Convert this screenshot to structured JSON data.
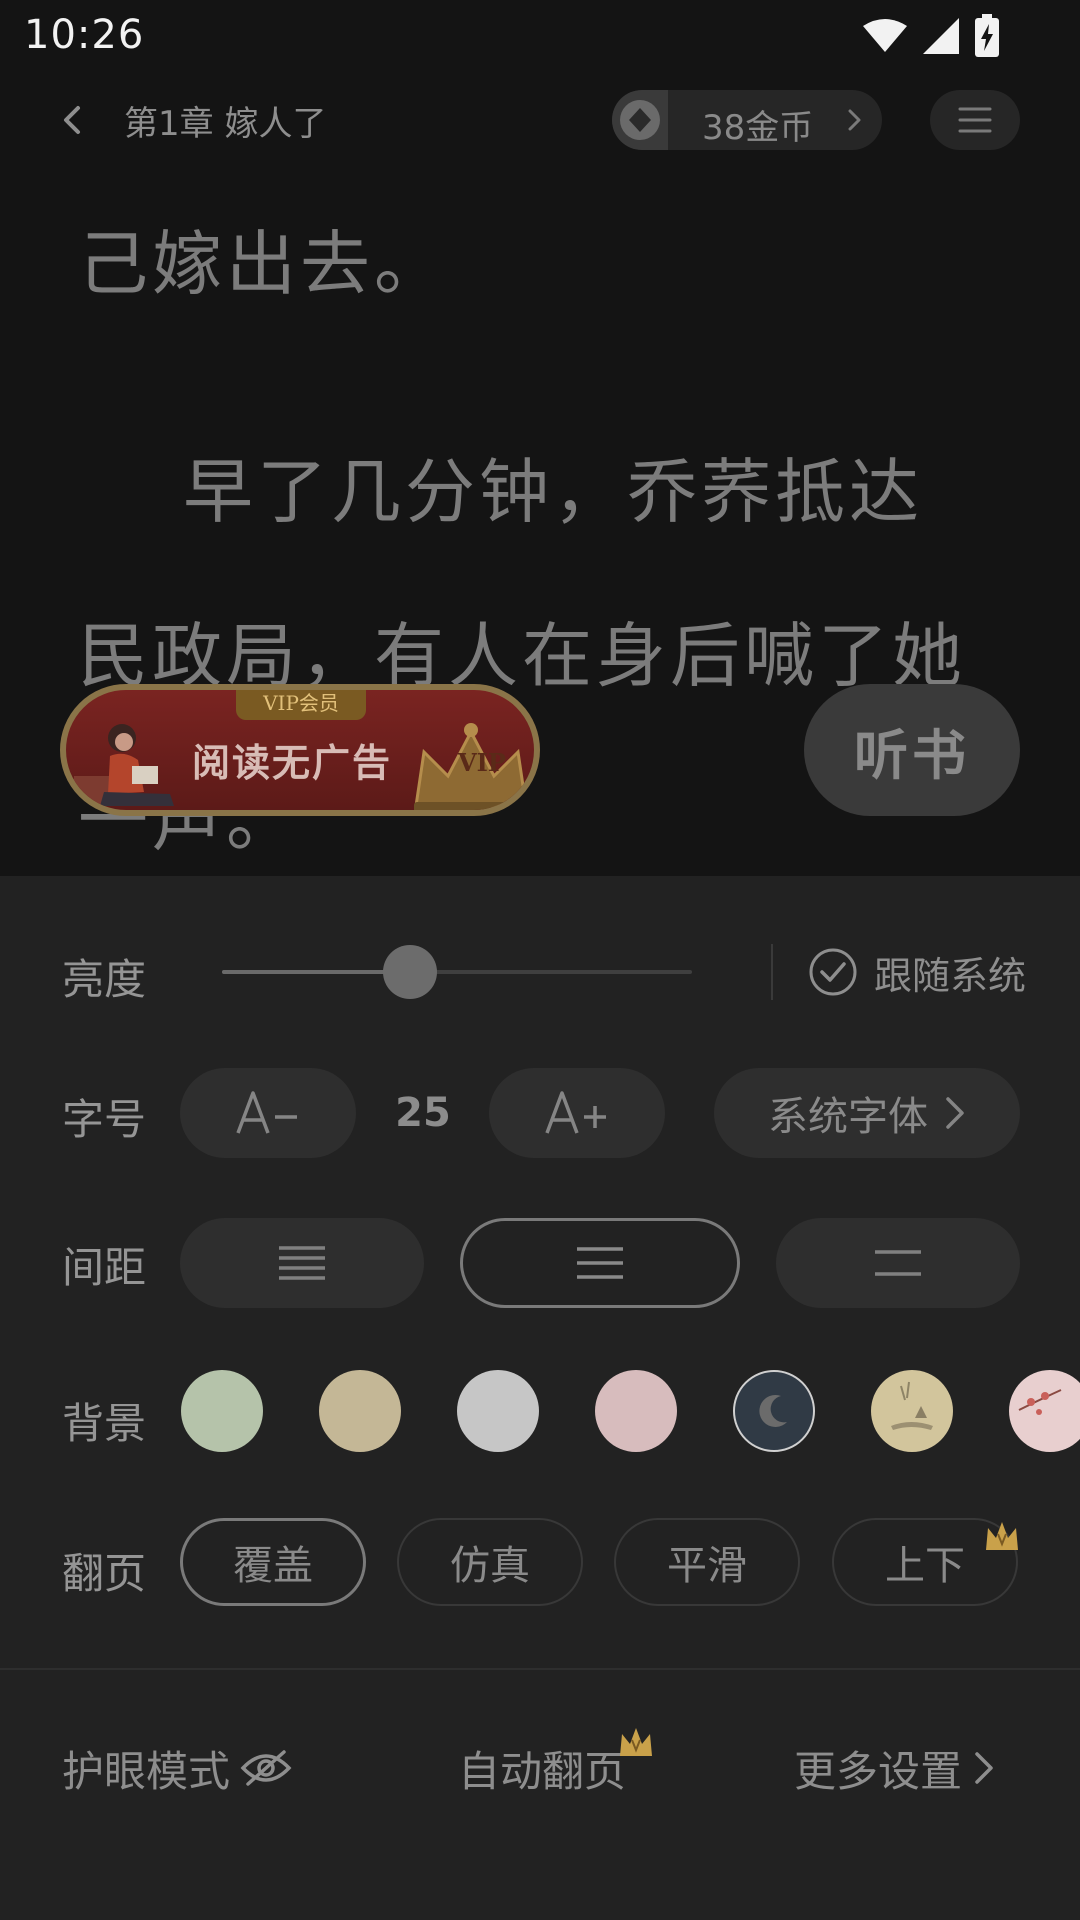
{
  "status_bar": {
    "time": "10:26",
    "icons": [
      "wifi-icon",
      "cellular-signal-icon",
      "battery-charging-icon"
    ]
  },
  "top_bar": {
    "chapter_title": "第1章  嫁人了",
    "coins": "38金币",
    "icons": [
      "back-arrow-icon",
      "coin-icon",
      "chevron-right-icon",
      "menu-icon"
    ]
  },
  "article": {
    "lines": [
      "己嫁出去。",
      "    早了几分钟，乔荞抵达",
      "民政局，有人在身后喊了她",
      "一声。"
    ]
  },
  "overlay": {
    "vip_tag": "VIP会员",
    "vip_text": "阅读无广告",
    "vip_crown_text": "VIP",
    "listen_button": "听书"
  },
  "settings": {
    "brightness": {
      "label": "亮度",
      "value_fraction": 0.4,
      "follow_system": "跟随系统",
      "follow_system_checked": true
    },
    "font_size": {
      "label": "字号",
      "decrease": "A−",
      "value": "25",
      "increase": "A+",
      "font_family": "系统字体"
    },
    "spacing": {
      "label": "间距",
      "options": [
        "compact",
        "medium",
        "loose"
      ],
      "selected_index": 1
    },
    "background": {
      "label": "背景",
      "swatches": [
        "#b5c3aa",
        "#c4b796",
        "#c6c6c6",
        "#d7bcbd",
        "#303a45",
        "#d2c59c",
        "#e8cfcf"
      ],
      "selected_index": 4
    },
    "page_turn": {
      "label": "翻页",
      "options": [
        "覆盖",
        "仿真",
        "平滑",
        "上下"
      ],
      "selected_index": 0
    }
  },
  "bottom_actions": {
    "eye_care": "护眼模式",
    "auto_page": "自动翻页",
    "more_settings": "更多设置"
  },
  "colors": {
    "panel_bg": "#222222",
    "vip_gold": "#c9a14a"
  }
}
